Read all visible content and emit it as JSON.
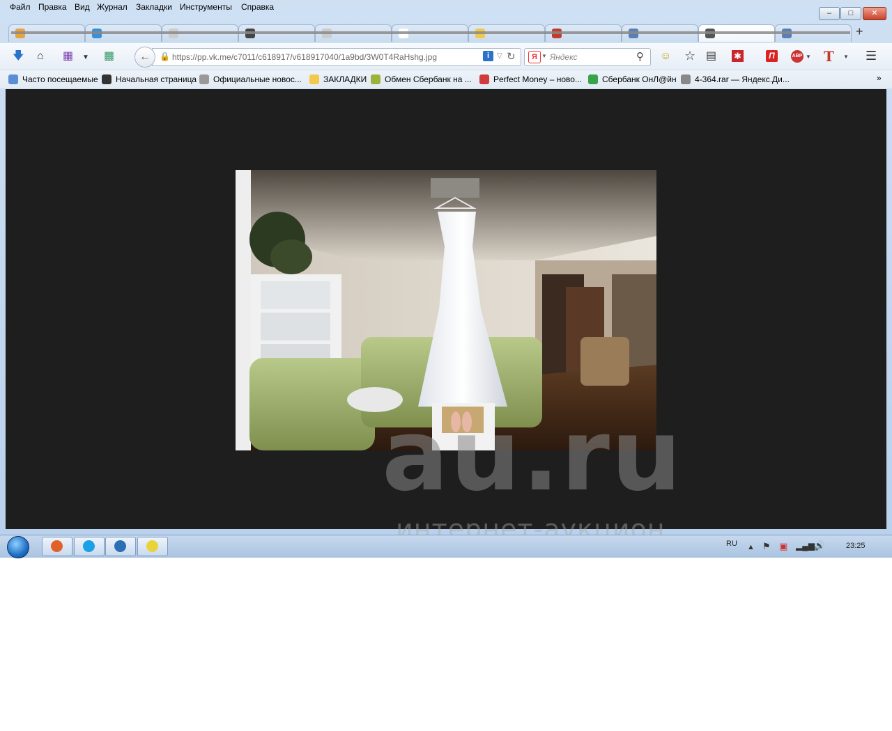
{
  "menu": [
    "Файл",
    "Правка",
    "Вид",
    "Журнал",
    "Закладки",
    "Инструменты",
    "Справка"
  ],
  "window_controls": {
    "minimize": "–",
    "maximize": "□",
    "close": "✕"
  },
  "tabs": [
    {
      "icon_color": "#e8a33c"
    },
    {
      "icon_color": "#3a8fd6"
    },
    {
      "icon_color": "#cccccc"
    },
    {
      "icon_color": "#444444"
    },
    {
      "icon_color": "#cccccc"
    },
    {
      "icon_color": "#ffffff"
    },
    {
      "icon_color": "#f0c94a"
    },
    {
      "icon_color": "#c23b2b"
    },
    {
      "icon_color": "#5a7fb5"
    },
    {
      "icon_color": "#555555",
      "active": true
    },
    {
      "icon_color": "#5a7fb5"
    }
  ],
  "new_tab": "+",
  "navbar": {
    "url": "https://pp.vk.me/c7011/c618917/v618917040/1a9bd/3W0T4RaHshg.jpg",
    "search_engine_icon": "Я",
    "search_placeholder": "Яндекс",
    "abp_label": "ABP",
    "t_label": "T",
    "pi_label": "П"
  },
  "bookmarks": [
    {
      "label": "Часто посещаемые",
      "icon_color": "#5b8ed6"
    },
    {
      "label": "Начальная страница",
      "icon_color": "#333333"
    },
    {
      "label": "Официальные новос...",
      "icon_color": "#999999"
    },
    {
      "label": "ЗАКЛАДКИ",
      "icon_color": "#f2c94c"
    },
    {
      "label": "Обмен Сбербанк на ...",
      "icon_color": "#9bb33a"
    },
    {
      "label": "Perfect Money – ново...",
      "icon_color": "#d23b3b"
    },
    {
      "label": "Сбербанк ОнЛ@йн",
      "icon_color": "#3aa34a"
    },
    {
      "label": "4-364.rar — Яндекс.Ди...",
      "icon_color": "#888888"
    }
  ],
  "bookmarks_overflow": "»",
  "watermark": {
    "main": "au.ru",
    "sub": "интернет-аукцион"
  },
  "taskbar": {
    "buttons": [
      {
        "name": "firefox",
        "color": "#e0622a"
      },
      {
        "name": "skype",
        "color": "#1aa0e6"
      },
      {
        "name": "network-app",
        "color": "#2b6fb5"
      },
      {
        "name": "pointer-app",
        "color": "#e8d43a"
      }
    ],
    "lang": "RU",
    "clock": "23:25"
  }
}
